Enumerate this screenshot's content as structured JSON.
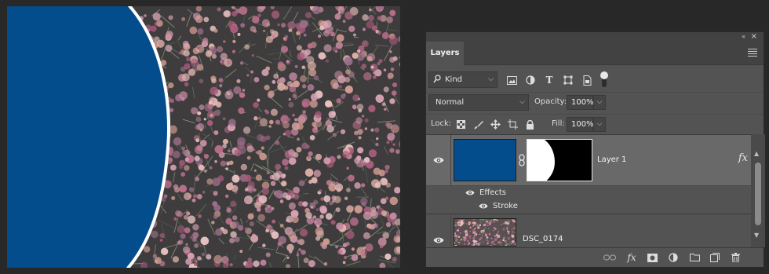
{
  "colors": {
    "layer_fill": "#034d8d",
    "panel_bg": "#535353",
    "selected_row": "#696969",
    "app_bg": "#282828"
  },
  "panel": {
    "tab_label": "Layers",
    "menu_icon": "panel-menu-icon",
    "collapse_icon": "«",
    "close_icon": "×"
  },
  "filter": {
    "kind_label": "Kind",
    "icons": [
      "image-filter-icon",
      "adjustment-filter-icon",
      "text-filter-icon",
      "shape-filter-icon",
      "smart-object-filter-icon"
    ],
    "text_icon_glyph": "T"
  },
  "blend": {
    "mode": "Normal",
    "opacity_label": "Opacity:",
    "opacity_value": "100%",
    "lock_label": "Lock:",
    "fill_label": "Fill:",
    "fill_value": "100%"
  },
  "layers": {
    "layer1": {
      "name": "Layer 1",
      "fx_badge": "fx",
      "effects_label": "Effects",
      "stroke_label": "Stroke"
    },
    "background": {
      "name": "DSC_0174"
    }
  },
  "bottom_icons": [
    "link-layers-icon",
    "add-style-icon",
    "add-mask-icon",
    "adjustment-layer-icon",
    "new-group-icon",
    "new-layer-icon",
    "delete-icon"
  ],
  "bottom_fx_glyph": "fx"
}
